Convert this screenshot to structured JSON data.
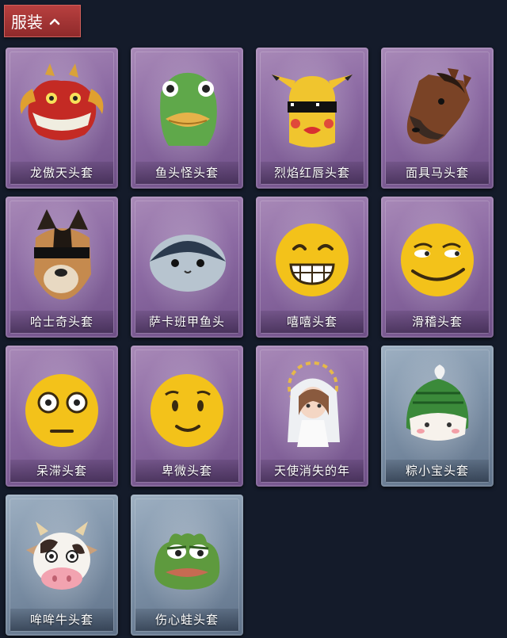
{
  "header": {
    "title": "服装",
    "toggle_icon": "chevron-up-icon"
  },
  "items": [
    {
      "label": "龙傲天头套",
      "icon": "dragon-head-icon",
      "theme": "purple"
    },
    {
      "label": "鱼头怪头套",
      "icon": "fish-head-icon",
      "theme": "purple"
    },
    {
      "label": "烈焰红唇头套",
      "icon": "pikachu-lips-icon",
      "theme": "purple"
    },
    {
      "label": "面具马头套",
      "icon": "horse-head-icon",
      "theme": "purple"
    },
    {
      "label": "哈士奇头套",
      "icon": "husky-head-icon",
      "theme": "purple"
    },
    {
      "label": "萨卡班甲鱼头",
      "icon": "sacabambaspis-icon",
      "theme": "purple"
    },
    {
      "label": "嘻嘻头套",
      "icon": "grin-emoji-icon",
      "theme": "purple"
    },
    {
      "label": "滑稽头套",
      "icon": "funny-emoji-icon",
      "theme": "purple"
    },
    {
      "label": "呆滞头套",
      "icon": "dazed-emoji-icon",
      "theme": "purple"
    },
    {
      "label": "卑微头套",
      "icon": "humble-emoji-icon",
      "theme": "purple"
    },
    {
      "label": "天使消失的年",
      "icon": "angel-girl-icon",
      "theme": "purple"
    },
    {
      "label": "粽小宝头套",
      "icon": "zongzi-head-icon",
      "theme": "blue"
    },
    {
      "label": "哞哞牛头套",
      "icon": "cow-head-icon",
      "theme": "blue"
    },
    {
      "label": "伤心蛙头套",
      "icon": "sad-frog-icon",
      "theme": "blue"
    }
  ]
}
